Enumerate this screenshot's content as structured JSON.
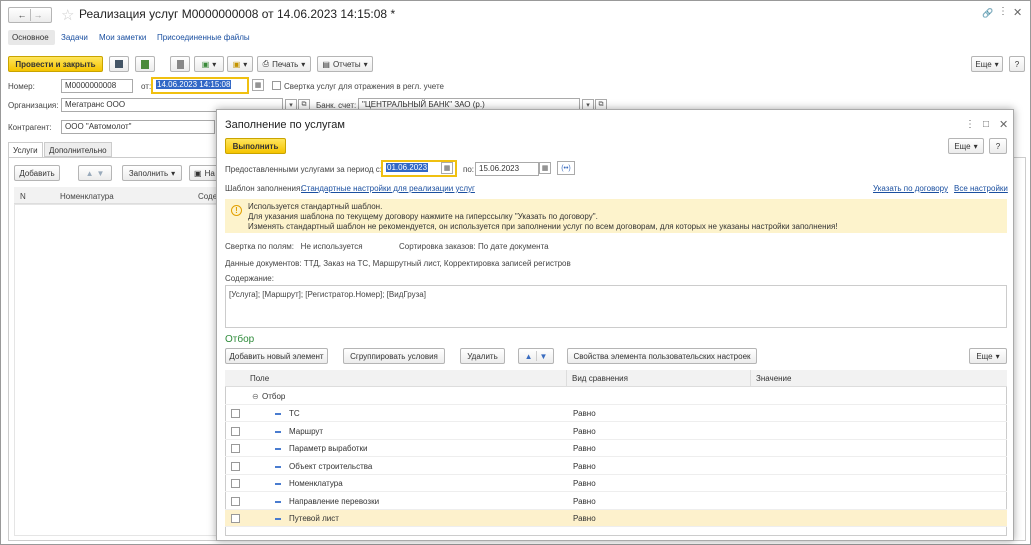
{
  "doc": {
    "title": "Реализация услуг М0000000008 от 14.06.2023 14:15:08 *",
    "tabs": [
      "Основное",
      "Задачи",
      "Мои заметки",
      "Присоединенные файлы"
    ],
    "toolbar": {
      "post_close": "Провести и закрыть",
      "print": "Печать",
      "reports": "Отчеты",
      "more": "Еще",
      "help": "?"
    },
    "number_label": "Номер:",
    "number_value": "М0000000008",
    "from_label": "от:",
    "date_value": "14.06.2023 14:15:08",
    "fold_label": "Свертка услуг для отражения в регл. учете",
    "org_label": "Организация:",
    "org_value": "Мегатранс ООО",
    "bank_label": "Банк. счет:",
    "bank_value": "\"ЦЕНТРАЛЬНЫЙ БАНК\" ЗАО (р.)",
    "counterparty_label": "Контрагент:",
    "counterparty_value": "ООО \"Автомолот\"",
    "inner_tabs": [
      "Услуги",
      "Дополнительно"
    ],
    "add_btn": "Добавить",
    "fill_btn": "Заполнить",
    "na_btn": "На",
    "col_n": "N",
    "col_nom": "Номенклатура",
    "col_code": "Соде"
  },
  "dialog": {
    "title": "Заполнение по услугам",
    "execute": "Выполнить",
    "more": "Еще",
    "help": "?",
    "period_label": "Предоставленными услугами за период с:",
    "date_from": "01.06.2023",
    "to_label": "по:",
    "date_to": "15.06.2023",
    "template_label": "Шаблон заполнения:",
    "template_link": "Стандартные настройки для реализации услуг",
    "by_contract_link": "Указать по договору",
    "all_settings_link": "Все настройки",
    "warning_lines": [
      "Используется стандартный шаблон.",
      "Для указания шаблона по текущему договору нажмите на гиперссылку \"Указать по договору\".",
      "Изменять стандартный шаблон не рекомендуется, он используется при заполнении услуг по всем договорам, для которых не указаны настройки заполнения!"
    ],
    "fold_fields": "Свертка по полям:   Не используется",
    "order_sort": "Сортировка заказов: По дате документа",
    "doc_data": "Данные документов: ТТД, Заказ на ТС, Маршрутный лист, Корректировка записей регистров",
    "content_label": "Содержание:",
    "content_value": "[Услуга]; [Маршрут]; [Регистратор.Номер]; [ВидГруза]",
    "filter_title": "Отбор",
    "filter_buttons": {
      "add": "Добавить новый элемент",
      "group": "Сгруппировать условия",
      "delete": "Удалить",
      "props": "Свойства элемента пользовательских настроек",
      "more": "Еще"
    },
    "grid_headers": [
      "Поле",
      "Вид сравнения",
      "Значение"
    ],
    "group_row": "Отбор",
    "rows": [
      {
        "field": "ТС",
        "cmp": "Равно"
      },
      {
        "field": "Маршрут",
        "cmp": "Равно"
      },
      {
        "field": "Параметр выработки",
        "cmp": "Равно"
      },
      {
        "field": "Объект строительства",
        "cmp": "Равно"
      },
      {
        "field": "Номенклатура",
        "cmp": "Равно"
      },
      {
        "field": "Направление перевозки",
        "cmp": "Равно"
      },
      {
        "field": "Путевой лист",
        "cmp": "Равно"
      }
    ],
    "selected_row_index": 6
  },
  "colors": {
    "accent_yellow": "#f5c400",
    "link": "#1a4fa0",
    "title_green": "#2e8b3a",
    "selection": "#fdf1cc"
  }
}
